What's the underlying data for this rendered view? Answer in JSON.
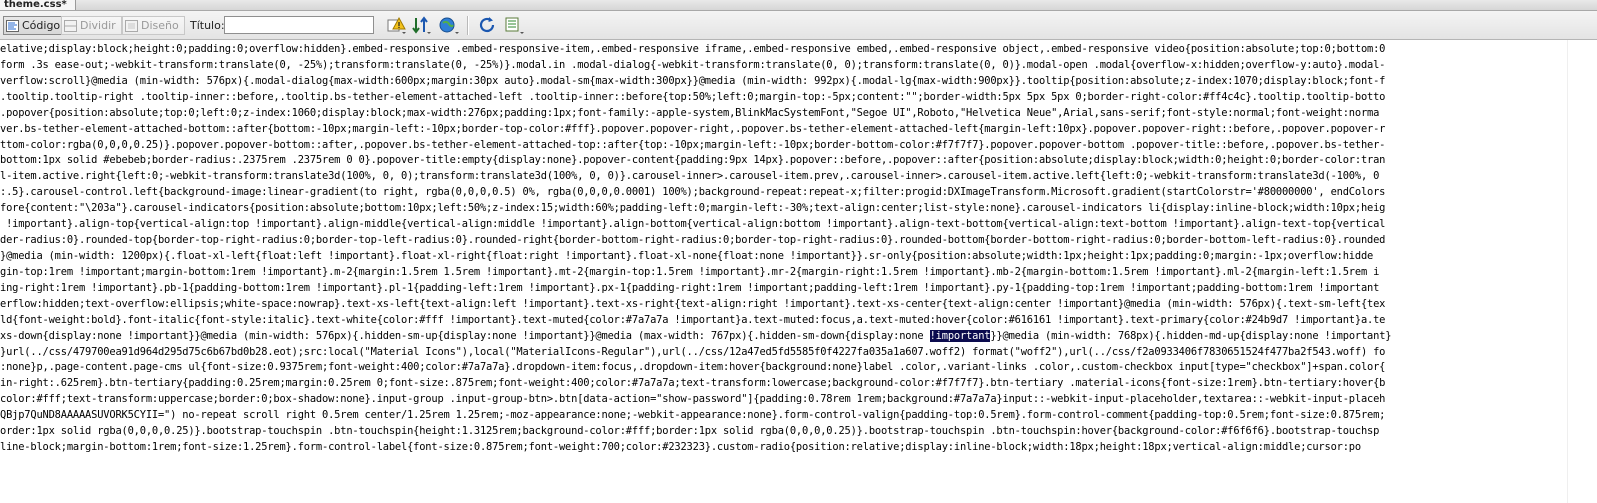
{
  "tab": {
    "label": "theme.css*"
  },
  "toolbar": {
    "code_label": "Código",
    "split_label": "Dividir",
    "design_label": "Diseño",
    "title_label": "Título:",
    "title_value": ""
  },
  "code_lines": [
    "elative;display:block;height:0;padding:0;overflow:hidden}.embed-responsive .embed-responsive-item,.embed-responsive iframe,.embed-responsive embed,.embed-responsive object,.embed-responsive video{position:absolute;top:0;bottom:0",
    "form .3s ease-out;-webkit-transform:translate(0, -25%);transform:translate(0, -25%)}.modal.in .modal-dialog{-webkit-transform:translate(0, 0);transform:translate(0, 0)}.modal-open .modal{overflow-x:hidden;overflow-y:auto}.modal-",
    "verflow:scroll}@media (min-width: 576px){.modal-dialog{max-width:600px;margin:30px auto}.modal-sm{max-width:300px}}@media (min-width: 992px){.modal-lg{max-width:900px}}.tooltip{position:absolute;z-index:1070;display:block;font-f",
    ".tooltip.tooltip-right .tooltip-inner::before,.tooltip.bs-tether-element-attached-left .tooltip-inner::before{top:50%;left:0;margin-top:-5px;content:\"\";border-width:5px 5px 5px 0;border-right-color:#ff4c4c}.tooltip.tooltip-botto",
    ".popover{position:absolute;top:0;left:0;z-index:1060;display:block;max-width:276px;padding:1px;font-family:-apple-system,BlinkMacSystemFont,\"Segoe UI\",Roboto,\"Helvetica Neue\",Arial,sans-serif;font-style:normal;font-weight:norma",
    "ver.bs-tether-element-attached-bottom::after{bottom:-10px;margin-left:-10px;border-top-color:#fff}.popover.popover-right,.popover.bs-tether-element-attached-left{margin-left:10px}.popover.popover-right::before,.popover.popover-r",
    "ttom-color:rgba(0,0,0,0.25)}.popover.popover-bottom::after,.popover.bs-tether-element-attached-top::after{top:-10px;margin-left:-10px;border-bottom-color:#f7f7f7}.popover.popover-bottom .popover-title::before,.popover.bs-tether-",
    "bottom:1px solid #ebebeb;border-radius:.2375rem .2375rem 0 0}.popover-title:empty{display:none}.popover-content{padding:9px 14px}.popover::before,.popover::after{position:absolute;display:block;width:0;height:0;border-color:tran",
    "l-item.active.right{left:0;-webkit-transform:translate3d(100%, 0, 0);transform:translate3d(100%, 0, 0)}.carousel-inner>.carousel-item.prev,.carousel-inner>.carousel-item.active.left{left:0;-webkit-transform:translate3d(-100%, 0",
    ":.5}.carousel-control.left{background-image:linear-gradient(to right, rgba(0,0,0,0.5) 0%, rgba(0,0,0,0.0001) 100%);background-repeat:repeat-x;filter:progid:DXImageTransform.Microsoft.gradient(startColorstr='#80000000', endColors",
    "fore{content:\"\\203a\"}.carousel-indicators{position:absolute;bottom:10px;left:50%;z-index:15;width:60%;padding-left:0;margin-left:-30%;text-align:center;list-style:none}.carousel-indicators li{display:inline-block;width:10px;heig",
    " !important}.align-top{vertical-align:top !important}.align-middle{vertical-align:middle !important}.align-bottom{vertical-align:bottom !important}.align-text-bottom{vertical-align:text-bottom !important}.align-text-top{vertical",
    "der-radius:0}.rounded-top{border-top-right-radius:0;border-top-left-radius:0}.rounded-right{border-bottom-right-radius:0;border-top-right-radius:0}.rounded-bottom{border-bottom-right-radius:0;border-bottom-left-radius:0}.rounded",
    "}@media (min-width: 1200px){.float-xl-left{float:left !important}.float-xl-right{float:right !important}.float-xl-none{float:none !important}}.sr-only{position:absolute;width:1px;height:1px;padding:0;margin:-1px;overflow:hidde",
    "gin-top:1rem !important;margin-bottom:1rem !important}.m-2{margin:1.5rem 1.5rem !important}.mt-2{margin-top:1.5rem !important}.mr-2{margin-right:1.5rem !important}.mb-2{margin-bottom:1.5rem !important}.ml-2{margin-left:1.5rem i",
    "ing-right:1rem !important}.pb-1{padding-bottom:1rem !important}.pl-1{padding-left:1rem !important}.px-1{padding-right:1rem !important;padding-left:1rem !important}.py-1{padding-top:1rem !important;padding-bottom:1rem !important",
    "erflow:hidden;text-overflow:ellipsis;white-space:nowrap}.text-xs-left{text-align:left !important}.text-xs-right{text-align:right !important}.text-xs-center{text-align:center !important}@media (min-width: 576px){.text-sm-left{tex",
    "ld{font-weight:bold}.font-italic{font-style:italic}.text-white{color:#fff !important}.text-muted{color:#7a7a7a !important}a.text-muted:focus,a.text-muted:hover{color:#616161 !important}.text-primary{color:#24b9d7 !important}a.te",
    "xs-down{display:none !important}}@media (min-width: 576px){.hidden-sm-up{display:none !important}}@media (max-width: 767px){.hidden-sm-down{display:none ",
    "}url(../css/479700ea91d964d295d75c6b67bd0b28.eot);src:local(\"Material Icons\"),local(\"MaterialIcons-Regular\"),url(../css/12a47ed5fd5585f0f4227fa035a1a607.woff2) format(\"woff2\"),url(../css/f2a0933406f7830651524f477ba2f543.woff) fo",
    ":none}p,.page-content.page-cms ul{font-size:0.9375rem;font-weight:400;color:#7a7a7a}.dropdown-item:focus,.dropdown-item:hover{background:none}label .color,.variant-links .color,.custom-checkbox input[type=\"checkbox\"]+span.color{",
    "in-right:.625rem}.btn-tertiary{padding:0.25rem;margin:0.25rem 0;font-size:.875rem;font-weight:400;color:#7a7a7a;text-transform:lowercase;background-color:#f7f7f7}.btn-tertiary .material-icons{font-size:1rem}.btn-tertiary:hover{b",
    "color:#fff;text-transform:uppercase;border:0;box-shadow:none}.input-group .input-group-btn>.btn[data-action=\"show-password\"]{padding:0.78rem 1rem;background:#7a7a7a}input::-webkit-input-placeholder,textarea::-webkit-input-placeh",
    "QBjp7QuND8AAAAASUVORK5CYII=\") no-repeat scroll right 0.5rem center/1.25rem 1.25rem;-moz-appearance:none;-webkit-appearance:none}.form-control-valign{padding-top:0.5rem}.form-control-comment{padding-top:0.5rem;font-size:0.875rem;",
    "order:1px solid rgba(0,0,0,0.25)}.bootstrap-touchspin .btn-touchspin{height:1.3125rem;background-color:#fff;border:1px solid rgba(0,0,0,0.25)}.bootstrap-touchspin .btn-touchspin:hover{background-color:#f6f6f6}.bootstrap-touchsp",
    "line-block;margin-bottom:1rem;font-size:1.25rem}.form-control-label{font-size:0.875rem;font-weight:700;color:#232323}.custom-radio{position:relative;display:inline-block;width:18px;height:18px;vertical-align:middle;cursor:po"
  ],
  "highlight": {
    "line_index": 18,
    "selected_text": "!important",
    "tail_text": "}}@media (min-width: 768px){.hidden-md-up{display:none !important}"
  }
}
